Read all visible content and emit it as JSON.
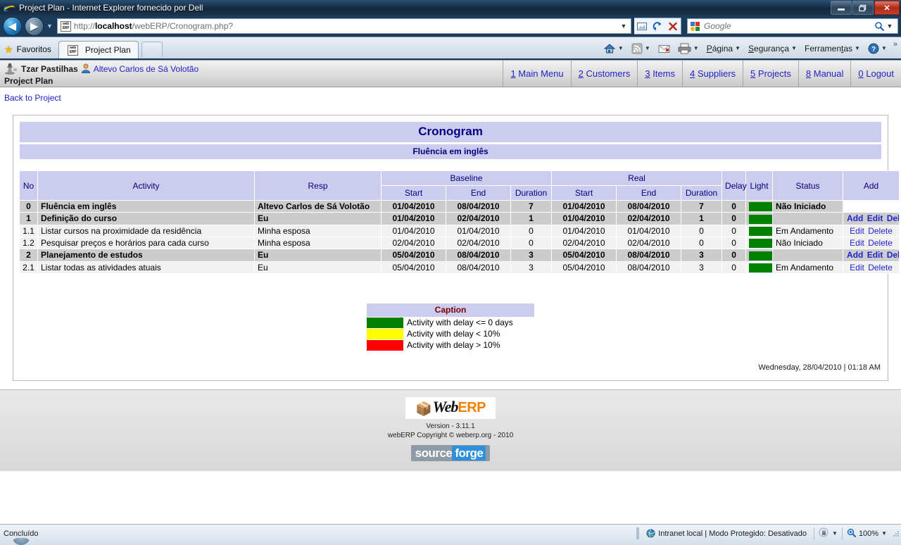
{
  "window": {
    "title": "Project Plan - Internet Explorer fornecido por Dell",
    "minimize_label": "—",
    "restore_label": "❐",
    "close_label": "✕"
  },
  "browser": {
    "back_label": "◀",
    "forward_label": "▶",
    "history_caret": "▼",
    "url_prefix": "http://",
    "url_host": "localhost",
    "url_path": "/webERP/Cronogram.php?",
    "address_dropdown": "▼",
    "compat_icon": "compatibility-view-icon",
    "refresh_label": "⟳",
    "stop_label": "✕",
    "search_placeholder": "Google",
    "search_dropdown": "▼",
    "favorites_label": "Favoritos",
    "tab_title": "Project Plan",
    "favicon_line1": "web",
    "favicon_line2": "ERP",
    "overflow_label": "»",
    "commands": [
      {
        "name": "home-button",
        "label": "",
        "icon": "home-icon",
        "caret": "▼"
      },
      {
        "name": "feeds-button",
        "label": "",
        "icon": "rss-icon",
        "caret": "▼"
      },
      {
        "name": "mail-button",
        "label": "",
        "icon": "mail-icon",
        "caret": ""
      },
      {
        "name": "print-button",
        "label": "",
        "icon": "printer-icon",
        "caret": "▼"
      },
      {
        "name": "page-menu",
        "label": "Página",
        "accesskey": "P",
        "icon": "",
        "caret": "▼"
      },
      {
        "name": "safety-menu",
        "label": "Segurança",
        "accesskey": "S",
        "icon": "",
        "caret": "▼"
      },
      {
        "name": "tools-menu",
        "label": "Ferramentas",
        "accesskey": "a",
        "icon": "",
        "caret": "▼"
      },
      {
        "name": "help-menu",
        "label": "",
        "icon": "help-icon",
        "caret": "▼"
      }
    ]
  },
  "app_header": {
    "company_icon": "chess-piece-icon",
    "company_name": "Tzar Pastilhas",
    "user_icon": "user-icon",
    "user_name": "Altevo Carlos de Sá Volotão",
    "page_name": "Project Plan",
    "nav": [
      {
        "key": "1",
        "label": "Main Menu"
      },
      {
        "key": "2",
        "label": "Customers"
      },
      {
        "key": "3",
        "label": "Items"
      },
      {
        "key": "4",
        "label": "Suppliers"
      },
      {
        "key": "5",
        "label": "Projects"
      },
      {
        "key": "8",
        "label": "Manual"
      },
      {
        "key": "0",
        "label": "Logout"
      }
    ],
    "back_link": "Back to Project"
  },
  "report": {
    "title": "Cronogram",
    "subtitle": "Fluência em inglês",
    "columns": {
      "no": "No",
      "activity": "Activity",
      "resp": "Resp",
      "baseline": "Baseline",
      "real": "Real",
      "start": "Start",
      "end": "End",
      "duration": "Duration",
      "delay": "Delay",
      "light": "Light",
      "status": "Status",
      "add": "Add"
    },
    "rows": [
      {
        "no": "0",
        "activity": "Fluência em inglês",
        "resp": "Altevo Carlos de Sá Volotão",
        "baseline_start": "01/04/2010",
        "baseline_end": "08/04/2010",
        "baseline_duration": "7",
        "real_start": "01/04/2010",
        "real_end": "08/04/2010",
        "real_duration": "7",
        "delay": "0",
        "light_color": "#008000",
        "status": "Não Iniciado",
        "actions": [],
        "style": "group",
        "actions_cell_blank": true
      },
      {
        "no": "1",
        "activity": "Definição do curso",
        "resp": "Eu",
        "baseline_start": "01/04/2010",
        "baseline_end": "02/04/2010",
        "baseline_duration": "1",
        "real_start": "01/04/2010",
        "real_end": "02/04/2010",
        "real_duration": "1",
        "delay": "0",
        "light_color": "#008000",
        "status": "",
        "actions": [
          "Add",
          "Edit",
          "Del"
        ],
        "style": "group",
        "actions_cell_blank": false
      },
      {
        "no": "1.1",
        "activity": "Listar cursos na proximidade da residência",
        "resp": "Minha esposa",
        "baseline_start": "01/04/2010",
        "baseline_end": "01/04/2010",
        "baseline_duration": "0",
        "real_start": "01/04/2010",
        "real_end": "01/04/2010",
        "real_duration": "0",
        "delay": "0",
        "light_color": "#008000",
        "status": "Em Andamento",
        "actions": [
          "Edit",
          "Delete"
        ],
        "style": "sub",
        "actions_cell_blank": false
      },
      {
        "no": "1.2",
        "activity": "Pesquisar preços e horários para cada curso",
        "resp": "Minha esposa",
        "baseline_start": "02/04/2010",
        "baseline_end": "02/04/2010",
        "baseline_duration": "0",
        "real_start": "02/04/2010",
        "real_end": "02/04/2010",
        "real_duration": "0",
        "delay": "0",
        "light_color": "#008000",
        "status": "Não Iniciado",
        "actions": [
          "Edit",
          "Delete"
        ],
        "style": "sub",
        "actions_cell_blank": false
      },
      {
        "no": "2",
        "activity": "Planejamento de estudos",
        "resp": "Eu",
        "baseline_start": "05/04/2010",
        "baseline_end": "08/04/2010",
        "baseline_duration": "3",
        "real_start": "05/04/2010",
        "real_end": "08/04/2010",
        "real_duration": "3",
        "delay": "0",
        "light_color": "#008000",
        "status": "",
        "actions": [
          "Add",
          "Edit",
          "Del"
        ],
        "style": "group",
        "actions_cell_blank": false
      },
      {
        "no": "2.1",
        "activity": "Listar todas as atividades atuais",
        "resp": "Eu",
        "baseline_start": "05/04/2010",
        "baseline_end": "08/04/2010",
        "baseline_duration": "3",
        "real_start": "05/04/2010",
        "real_end": "08/04/2010",
        "real_duration": "3",
        "delay": "0",
        "light_color": "#008000",
        "status": "Em Andamento",
        "actions": [
          "Edit",
          "Delete"
        ],
        "style": "sub",
        "actions_cell_blank": false
      }
    ],
    "caption": {
      "title": "Caption",
      "entries": [
        {
          "color": "#008000",
          "label": "Activity with delay <= 0 days"
        },
        {
          "color": "#ffff00",
          "label": "Activity with delay < 10%"
        },
        {
          "color": "#ff0000",
          "label": "Activity with delay > 10%"
        }
      ]
    },
    "timestamp": "Wednesday, 28/04/2010 | 01:18 AM"
  },
  "footer": {
    "logo_box": "📦",
    "logo_web": "Web",
    "logo_erp": "ERP",
    "version": "Version - 3.11.1",
    "copyright": "webERP Copyright © weberp.org - 2010",
    "sf_part1": "source",
    "sf_part2": "forge"
  },
  "statusbar": {
    "state": "Concluído",
    "zone": "Intranet local | Modo Protegido: Desativado",
    "zone_icon": "globe-icon",
    "lock_icon": "lock-icon",
    "lock_caret": "▼",
    "zoom_icon": "zoom-icon",
    "zoom_level": "100%",
    "zoom_caret": "▼"
  }
}
